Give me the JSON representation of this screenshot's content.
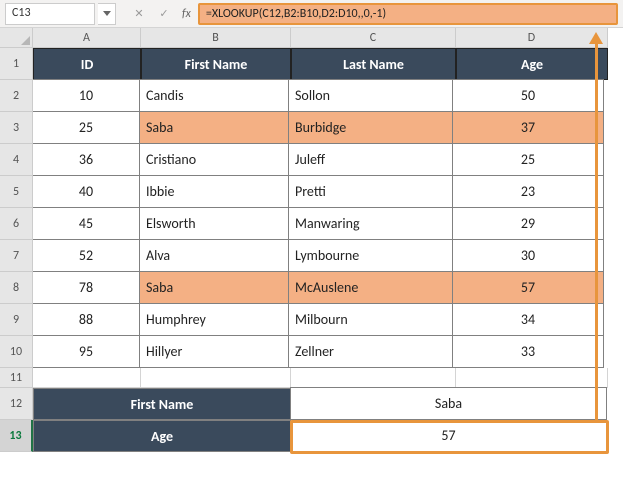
{
  "nameBox": "C13",
  "formula": "=XLOOKUP(C12,B2:B10,D2:D10,,0,-1)",
  "columns": [
    "A",
    "B",
    "C",
    "D"
  ],
  "rows": [
    "1",
    "2",
    "3",
    "4",
    "5",
    "6",
    "7",
    "8",
    "9",
    "10",
    "11",
    "12",
    "13"
  ],
  "headers": {
    "id": "ID",
    "first": "First Name",
    "last": "Last Name",
    "age": "Age"
  },
  "chart_data": {
    "type": "table",
    "columns": [
      "ID",
      "First Name",
      "Last Name",
      "Age"
    ],
    "rows": [
      [
        10,
        "Candis",
        "Sollon",
        50
      ],
      [
        25,
        "Saba",
        "Burbidge",
        37
      ],
      [
        36,
        "Cristiano",
        "Juleff",
        25
      ],
      [
        40,
        "Ibbie",
        "Pretti",
        23
      ],
      [
        45,
        "Elsworth",
        "Manwaring",
        29
      ],
      [
        52,
        "Alva",
        "Lymbourne",
        30
      ],
      [
        78,
        "Saba",
        "McAuslene",
        57
      ],
      [
        88,
        "Humphrey",
        "Milbourn",
        34
      ],
      [
        95,
        "Hillyer",
        "Zellner",
        33
      ]
    ]
  },
  "lookup": {
    "firstLabel": "First Name",
    "ageLabel": "Age",
    "firstValue": "Saba",
    "ageValue": "57"
  }
}
